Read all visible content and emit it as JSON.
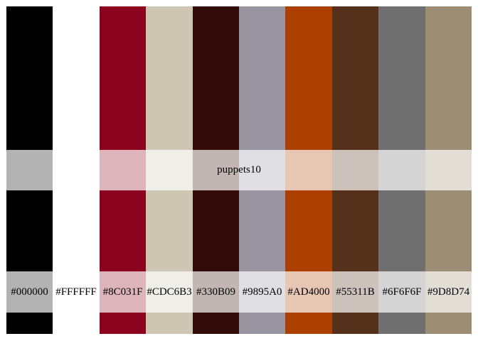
{
  "palette": {
    "name": "puppets10",
    "swatches": [
      {
        "hex": "#000000",
        "label": "#000000"
      },
      {
        "hex": "#FFFFFF",
        "label": "#FFFFFF"
      },
      {
        "hex": "#8C031F",
        "label": "#8C031F"
      },
      {
        "hex": "#CDC6B3",
        "label": "#CDC6B3"
      },
      {
        "hex": "#330B09",
        "label": "#330B09"
      },
      {
        "hex": "#9895A0",
        "label": "#9895A0"
      },
      {
        "hex": "#AD4000",
        "label": "#AD4000"
      },
      {
        "hex": "#55311B",
        "label": "#55311B"
      },
      {
        "hex": "#6F6F6F",
        "label": "#6F6F6F"
      },
      {
        "hex": "#9D8D74",
        "label": "#9D8D74"
      }
    ]
  }
}
